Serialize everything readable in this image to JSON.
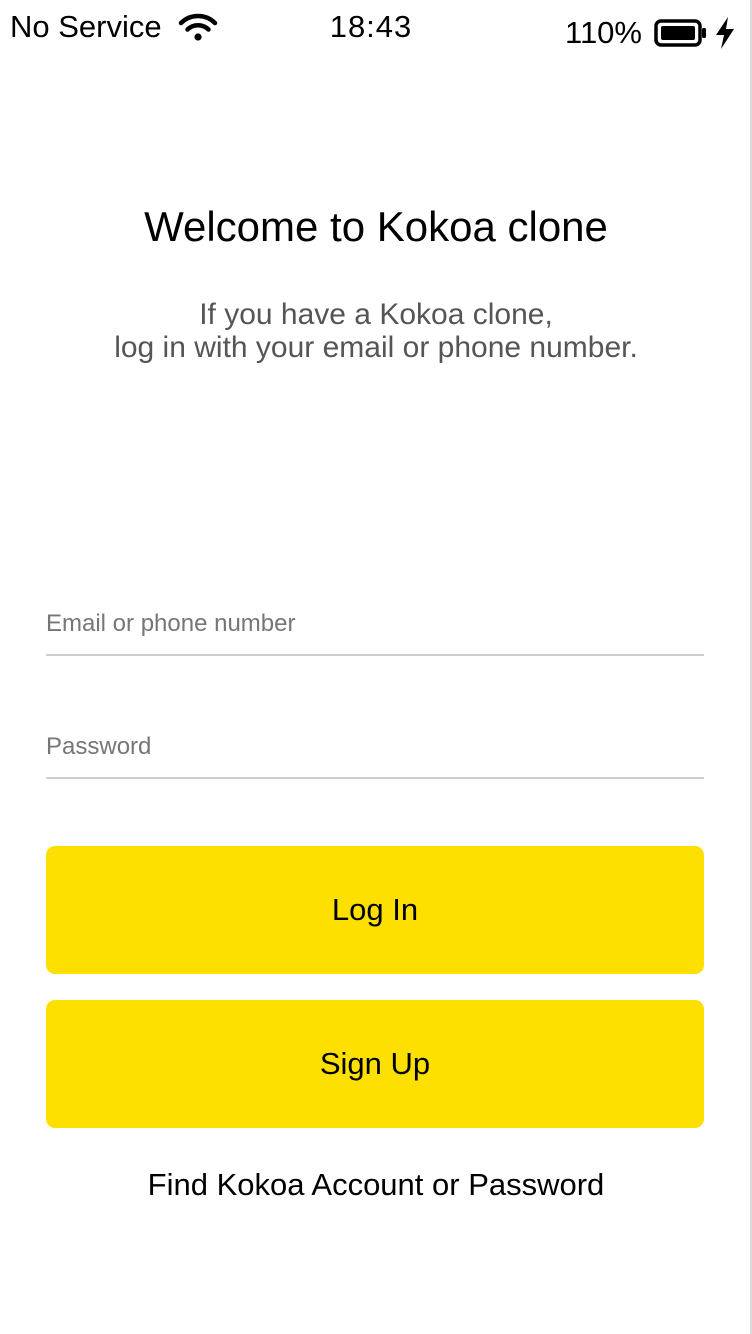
{
  "status_bar": {
    "carrier": "No Service",
    "time": "18:43",
    "battery_percent": "110%",
    "icons": {
      "wifi": "wifi-icon",
      "battery": "battery-icon",
      "charging": "bolt-icon"
    }
  },
  "welcome": {
    "title": "Welcome to Kokoa clone",
    "subtitle_line1": "If you have a Kokoa clone,",
    "subtitle_line2": "log in with your email or phone number."
  },
  "form": {
    "email": {
      "placeholder": "Email or phone number",
      "value": ""
    },
    "password": {
      "placeholder": "Password",
      "value": ""
    },
    "login_label": "Log In",
    "signup_label": "Sign Up",
    "find_account_label": "Find Kokoa Account or Password"
  },
  "colors": {
    "button_background": "#fde000",
    "placeholder_text": "#767676",
    "subtitle_text": "#555555",
    "field_underline": "#cfcfcf"
  }
}
